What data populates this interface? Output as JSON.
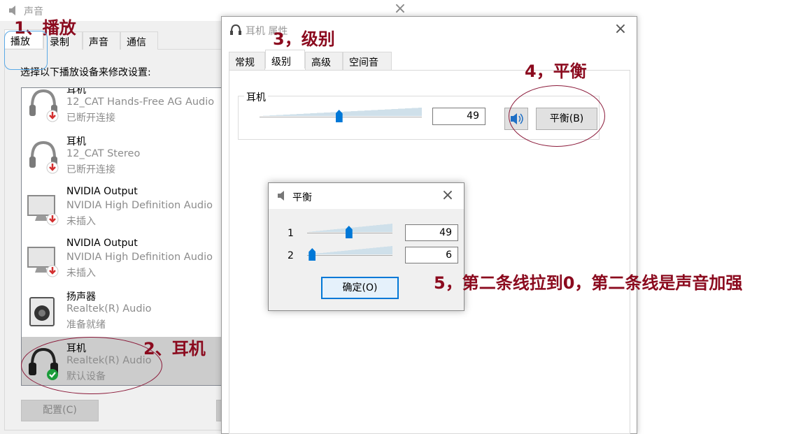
{
  "sound_window": {
    "title": "声音",
    "tabs": [
      {
        "label": "播放",
        "active": true
      },
      {
        "label": "录制",
        "active": false
      },
      {
        "label": "声音",
        "active": false
      },
      {
        "label": "通信",
        "active": false
      }
    ],
    "prompt": "选择以下播放设备来修改设置:",
    "devices": [
      {
        "name": "耳机",
        "driver": "12_CAT Hands-Free AG Audio",
        "status": "已断开连接",
        "icon": "headphone-disconnected-icon"
      },
      {
        "name": "耳机",
        "driver": "12_CAT Stereo",
        "status": "已断开连接",
        "icon": "headphone-disconnected-icon"
      },
      {
        "name": "NVIDIA Output",
        "driver": "NVIDIA High Definition Audio",
        "status": "未插入",
        "icon": "monitor-unplugged-icon"
      },
      {
        "name": "NVIDIA Output",
        "driver": "NVIDIA High Definition Audio",
        "status": "未插入",
        "icon": "monitor-unplugged-icon"
      },
      {
        "name": "扬声器",
        "driver": "Realtek(R) Audio",
        "status": "准备就绪",
        "icon": "speaker-icon"
      },
      {
        "name": "耳机",
        "driver": "Realtek(R) Audio",
        "status": "默认设备",
        "icon": "headphone-default-icon",
        "selected": true
      }
    ],
    "configure_button": "配置(C)"
  },
  "props_window": {
    "title": "耳机 属性",
    "tabs": [
      {
        "label": "常规",
        "active": false
      },
      {
        "label": "级别",
        "active": true
      },
      {
        "label": "高级",
        "active": false
      },
      {
        "label": "空间音效",
        "active": false
      }
    ],
    "level_label": "耳机",
    "level_value": "49",
    "level_fraction": 0.49,
    "balance_button": "平衡(B)"
  },
  "balance_dialog": {
    "title": "平衡",
    "channels": [
      {
        "label": "1",
        "value": "49",
        "fraction": 0.49
      },
      {
        "label": "2",
        "value": "6",
        "fraction": 0.06
      }
    ],
    "ok_button": "确定(O)"
  },
  "annotations": {
    "step1": "1、播放",
    "step2": "2、耳机",
    "step3": "3，级别",
    "step4": "4，平衡",
    "step5": "5，第二条线拉到0，第二条线是声音加强"
  },
  "colors": {
    "annotation": "#8b0a1e",
    "accent": "#0078d7",
    "default_check": "#1a9c3a",
    "status_red": "#d32f2f"
  }
}
